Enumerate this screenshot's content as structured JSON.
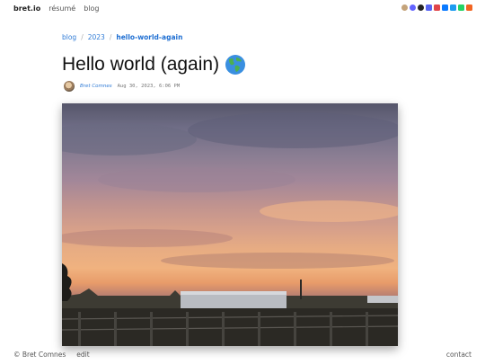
{
  "header": {
    "brand": "bret.io",
    "nav": [
      {
        "label": "résumé"
      },
      {
        "label": "blog"
      }
    ],
    "social_icons": [
      {
        "name": "owl-icon",
        "color": "#c4a37a"
      },
      {
        "name": "mastodon-icon",
        "color": "#6364ff"
      },
      {
        "name": "github-icon",
        "color": "#222222"
      },
      {
        "name": "discord-icon",
        "color": "#5865f2"
      },
      {
        "name": "app-icon",
        "color": "#e0454a"
      },
      {
        "name": "bluesky-icon",
        "color": "#0a7aff"
      },
      {
        "name": "twitter-icon",
        "color": "#1d9bf0"
      },
      {
        "name": "phone-icon",
        "color": "#25d366"
      },
      {
        "name": "rss-icon",
        "color": "#f26522"
      }
    ]
  },
  "breadcrumb": {
    "items": [
      "blog",
      "2023"
    ],
    "current": "hello-world-again",
    "separator": "/"
  },
  "post": {
    "title": "Hello world (again)",
    "author": "Bret Comnes",
    "date": "Aug 30, 2023, 6:06 PM"
  },
  "footer": {
    "copyright": "© Bret Comnes",
    "edit": "edit",
    "contact": "contact"
  }
}
